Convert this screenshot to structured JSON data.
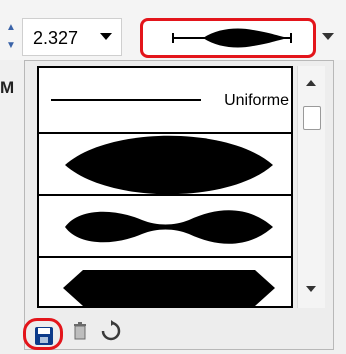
{
  "toolbar": {
    "stroke_weight_value": "2.327"
  },
  "left_label": "M",
  "width_profiles": [
    {
      "id": "uniform",
      "label": "Uniforme"
    },
    {
      "id": "profile-1",
      "label": ""
    },
    {
      "id": "profile-2",
      "label": ""
    },
    {
      "id": "profile-3",
      "label": ""
    }
  ],
  "buttons": {
    "save_icon": "save-icon",
    "delete_icon": "trash-icon",
    "reset_icon": "reset-icon"
  },
  "colors": {
    "highlight": "#e3151b",
    "accent": "#3a63a8"
  }
}
